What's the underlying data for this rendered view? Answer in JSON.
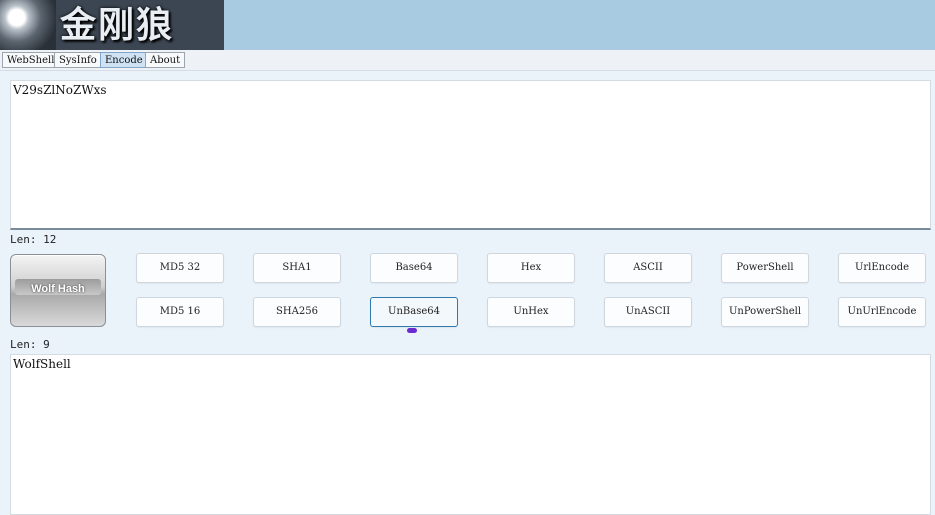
{
  "logo": {
    "text": "金刚狼",
    "icon": "wolf-logo-icon"
  },
  "tabs": [
    {
      "label": "WebShell"
    },
    {
      "label": "SysInfo"
    },
    {
      "label": "Encode",
      "active": true
    },
    {
      "label": "About"
    }
  ],
  "input": {
    "value": "V29sZlNoZWxs",
    "len_label": "Len: 12"
  },
  "wolf_button": {
    "label": "Wolf Hash"
  },
  "buttons_row1": [
    "MD5 32",
    "SHA1",
    "Base64",
    "Hex",
    "ASCII",
    "PowerShell",
    "UrlEncode"
  ],
  "buttons_row2": [
    "MD5 16",
    "SHA256",
    "UnBase64",
    "UnHex",
    "UnASCII",
    "UnPowerShell",
    "UnUrlEncode"
  ],
  "output": {
    "value": "WolfShell",
    "len_label": "Len: 9"
  },
  "colors": {
    "header_bg": "#a9cbe2",
    "accent_focus": "#2f79ad",
    "cursor_dot": "#6a2bd0"
  }
}
